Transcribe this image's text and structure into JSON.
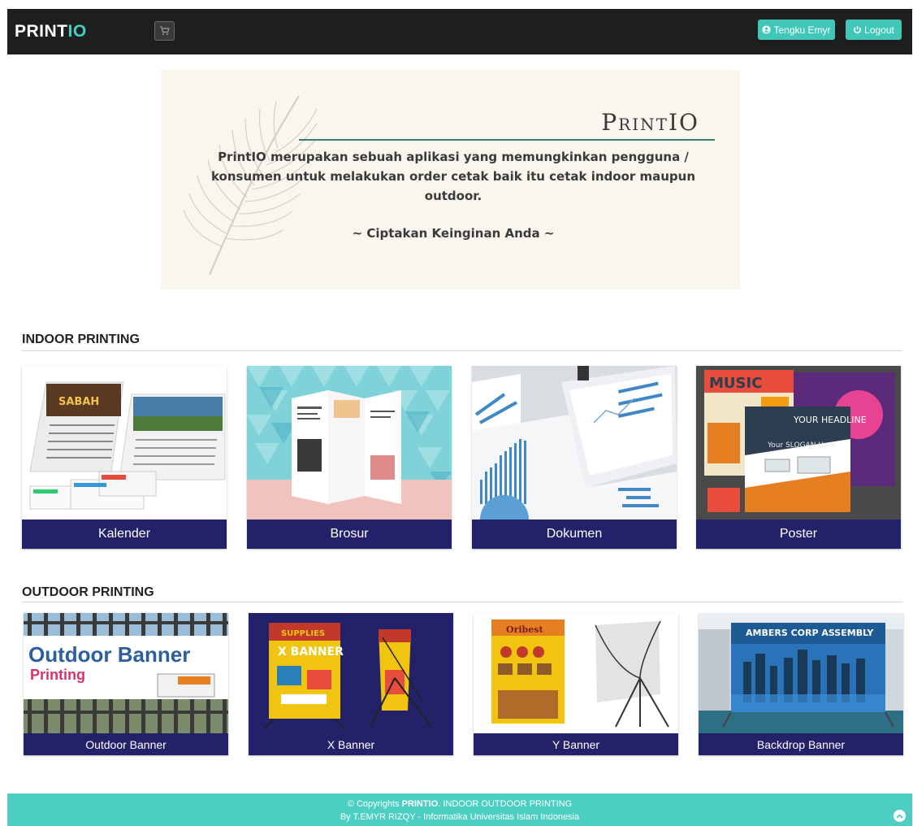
{
  "navbar": {
    "brand_part1": "PRINT",
    "brand_part2": "IO",
    "cart_icon": "shopping-cart-icon",
    "user_label": "Tengku Emyr",
    "logout_label": "Logout"
  },
  "hero": {
    "title": "PrintIO",
    "description": "PrintIO merupakan sebuah aplikasi yang memungkinkan pengguna / konsumen untuk melakukan order cetak baik itu cetak indoor maupun outdoor.",
    "tagline": "~ Ciptakan Keinginan Anda ~"
  },
  "indoor": {
    "title": "INDOOR PRINTING",
    "items": [
      {
        "label": "Kalender"
      },
      {
        "label": "Brosur"
      },
      {
        "label": "Dokumen"
      },
      {
        "label": "Poster"
      }
    ]
  },
  "outdoor": {
    "title": "OUTDOOR PRINTING",
    "items": [
      {
        "label": "Outdoor Banner"
      },
      {
        "label": "X Banner"
      },
      {
        "label": "Y Banner"
      },
      {
        "label": "Backdrop Banner"
      }
    ]
  },
  "footer": {
    "copyright_prefix": "© Copyrights ",
    "brand": "PRINTIO",
    "copyright_suffix": ". INDOOR OUTDOOR PRINTING",
    "byline": "By T.EMYR RIZQY - Informatika Universitas Islam Indonesia"
  },
  "colors": {
    "navbar_bg": "#1e1e1e",
    "accent": "#40c7b8",
    "card_label_bg": "#23216a",
    "footer_bg": "#4ccfc2"
  }
}
